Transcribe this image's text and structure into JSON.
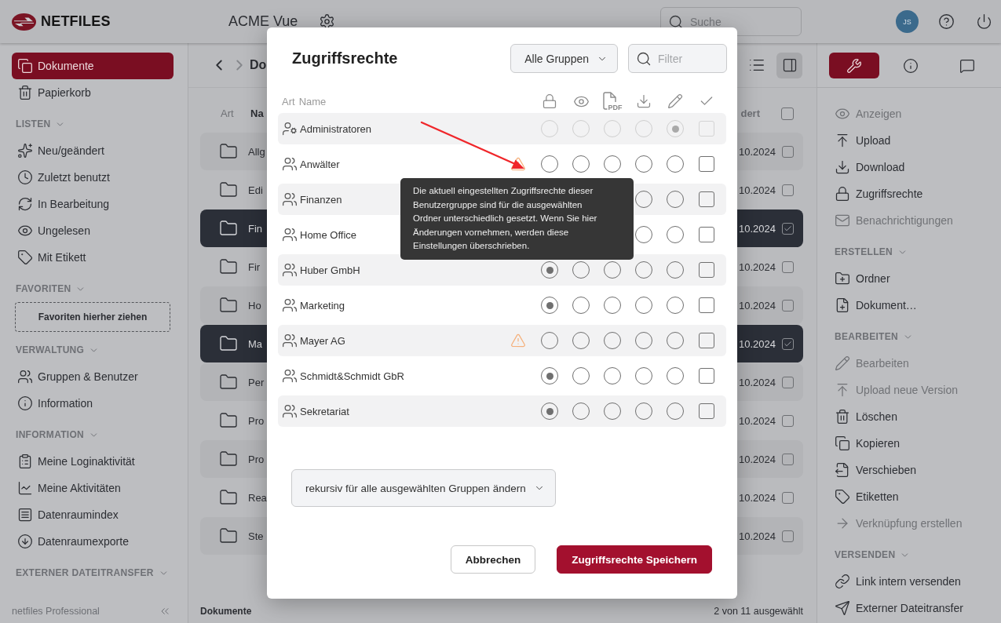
{
  "header": {
    "logo": "NETFILES",
    "workspace": "ACME Vue",
    "search": {
      "placeholder": "Suche"
    },
    "avatar": "JS"
  },
  "sidebar": {
    "items": [
      {
        "label": "Dokumente",
        "selected": true
      },
      {
        "label": "Papierkorb",
        "selected": false
      }
    ],
    "sections": [
      {
        "title": "LISTEN",
        "expanded": true,
        "items": [
          {
            "label": "Neu/geändert",
            "selected": false
          },
          {
            "label": "Zuletzt benutzt",
            "selected": false
          },
          {
            "label": "In Bearbeitung",
            "selected": false
          },
          {
            "label": "Ungelesen",
            "selected": false
          },
          {
            "label": "Mit Etikett",
            "selected": false
          }
        ]
      },
      {
        "title": "FAVORITEN",
        "expanded": true,
        "dropzone": "Favoriten hierher ziehen"
      },
      {
        "title": "VERWALTUNG",
        "expanded": true,
        "items": [
          {
            "label": "Gruppen & Benutzer",
            "selected": false
          },
          {
            "label": "Information",
            "selected": false
          }
        ]
      },
      {
        "title": "INFORMATION",
        "expanded": true,
        "items": [
          {
            "label": "Meine Loginaktivität",
            "selected": false
          },
          {
            "label": "Meine Aktivitäten",
            "selected": false
          },
          {
            "label": "Datenraumindex",
            "selected": false
          },
          {
            "label": "Datenraumexporte",
            "selected": false
          }
        ]
      },
      {
        "title": "EXTERNER DATEITRANSFER",
        "expanded": true
      }
    ],
    "footer": "netfiles Professional"
  },
  "main": {
    "breadcrumb": "Do",
    "columns": [
      {
        "label": "Art"
      },
      {
        "label": "Na"
      },
      {
        "label": "dert"
      }
    ],
    "select_all": {
      "checked": false
    },
    "rows": [
      {
        "name": "Allg",
        "date": "10.2024",
        "selected": false
      },
      {
        "name": "Edi",
        "date": "10.2024",
        "selected": false
      },
      {
        "name": "Fin",
        "date": "10.2024",
        "selected": true
      },
      {
        "name": "Fir",
        "date": "10.2024",
        "selected": false
      },
      {
        "name": "Ho",
        "date": "10.2024",
        "selected": false
      },
      {
        "name": "Ma",
        "date": "10.2024",
        "selected": true
      },
      {
        "name": "Per",
        "date": "10.2024",
        "selected": false
      },
      {
        "name": "Pro",
        "date": "10.2024",
        "selected": false
      },
      {
        "name": "Pro",
        "date": "10.2024",
        "selected": false
      },
      {
        "name": "Rea",
        "date": "10.2024",
        "selected": false
      },
      {
        "name": "Ste",
        "date": "10.2024",
        "selected": false
      }
    ],
    "status": {
      "location": "Dokumente",
      "selection": "2 von 11 ausgewählt"
    }
  },
  "panel": {
    "tabs": [
      {
        "selected": true
      },
      {
        "selected": false
      },
      {
        "selected": false
      }
    ],
    "items": [
      {
        "label": "Anzeigen",
        "disabled": true
      },
      {
        "label": "Upload",
        "disabled": false
      },
      {
        "label": "Download",
        "disabled": false
      },
      {
        "label": "Zugriffsrechte",
        "disabled": false
      },
      {
        "label": "Benachrichtigungen",
        "disabled": true
      }
    ],
    "sections": [
      {
        "title": "ERSTELLEN",
        "expanded": true,
        "items": [
          {
            "label": "Ordner",
            "disabled": false
          },
          {
            "label": "Dokument…",
            "disabled": false
          }
        ]
      },
      {
        "title": "BEARBEITEN",
        "expanded": true,
        "items": [
          {
            "label": "Bearbeiten",
            "disabled": true
          },
          {
            "label": "Upload neue Version",
            "disabled": true
          },
          {
            "label": "Löschen",
            "disabled": false
          },
          {
            "label": "Kopieren",
            "disabled": false
          },
          {
            "label": "Verschieben",
            "disabled": false
          },
          {
            "label": "Etiketten",
            "disabled": false
          },
          {
            "label": "Verknüpfung erstellen",
            "disabled": true
          }
        ]
      },
      {
        "title": "VERSENDEN",
        "expanded": true,
        "items": [
          {
            "label": "Link intern versenden",
            "disabled": false
          },
          {
            "label": "Externer Dateitransfer",
            "disabled": false
          }
        ]
      }
    ]
  },
  "dialog": {
    "title": "Zugriffsrechte",
    "group_select": "Alle Gruppen",
    "filter": {
      "placeholder": "Filter"
    },
    "columns": [
      {
        "label": "Art"
      },
      {
        "label": "Name"
      }
    ],
    "pdf_badge": "PDF",
    "rows": [
      {
        "name": "Administratoren",
        "kind": "admin",
        "disabled": true,
        "warning": false,
        "rights": [
          {
            "selected": false
          },
          {
            "selected": false
          },
          {
            "selected": false
          },
          {
            "selected": false
          },
          {
            "selected": true
          }
        ],
        "checked": false
      },
      {
        "name": "Anwälter",
        "kind": "group",
        "disabled": false,
        "warning": true,
        "rights": [
          {
            "selected": false
          },
          {
            "selected": false
          },
          {
            "selected": false
          },
          {
            "selected": false
          },
          {
            "selected": false
          }
        ],
        "checked": false
      },
      {
        "name": "Finanzen",
        "kind": "group",
        "disabled": false,
        "warning": false,
        "rights": [
          {
            "selected": false
          },
          {
            "selected": false
          }
        ],
        "checked": false
      },
      {
        "name": "Home Office",
        "kind": "group",
        "disabled": false,
        "warning": false,
        "rights": [
          {
            "selected": false
          },
          {
            "selected": false
          }
        ],
        "checked": false
      },
      {
        "name": "Huber GmbH",
        "kind": "group",
        "disabled": false,
        "warning": false,
        "rights": [
          {
            "selected": true
          },
          {
            "selected": false
          },
          {
            "selected": false
          },
          {
            "selected": false
          },
          {
            "selected": false
          }
        ],
        "checked": false
      },
      {
        "name": "Marketing",
        "kind": "group",
        "disabled": false,
        "warning": false,
        "rights": [
          {
            "selected": true
          },
          {
            "selected": false
          },
          {
            "selected": false
          },
          {
            "selected": false
          },
          {
            "selected": false
          }
        ],
        "checked": false
      },
      {
        "name": "Mayer AG",
        "kind": "group",
        "disabled": false,
        "warning": true,
        "rights": [
          {
            "selected": false
          },
          {
            "selected": false
          },
          {
            "selected": false
          },
          {
            "selected": false
          },
          {
            "selected": false
          }
        ],
        "checked": false
      },
      {
        "name": "Schmidt&Schmidt GbR",
        "kind": "group",
        "disabled": false,
        "warning": false,
        "rights": [
          {
            "selected": true
          },
          {
            "selected": false
          },
          {
            "selected": false
          },
          {
            "selected": false
          },
          {
            "selected": false
          }
        ],
        "checked": false
      },
      {
        "name": "Sekretariat",
        "kind": "group",
        "disabled": false,
        "warning": false,
        "rights": [
          {
            "selected": true
          },
          {
            "selected": false
          },
          {
            "selected": false
          },
          {
            "selected": false
          },
          {
            "selected": false
          }
        ],
        "checked": false
      }
    ],
    "tooltip": "Die aktuell eingestellten Zugriffsrechte dieser Benutzergruppe sind für die ausgewählten Ordner unterschiedlich gesetzt. Wenn Sie hier Änderungen vornehmen, werden diese Einstellungen überschrieben.",
    "apply_mode": "rekursiv für alle ausgewählten Gruppen ändern",
    "buttons": [
      {
        "label": "Abbrechen",
        "kind": "secondary"
      },
      {
        "label": "Zugriffsrechte Speichern",
        "kind": "primary"
      }
    ]
  }
}
